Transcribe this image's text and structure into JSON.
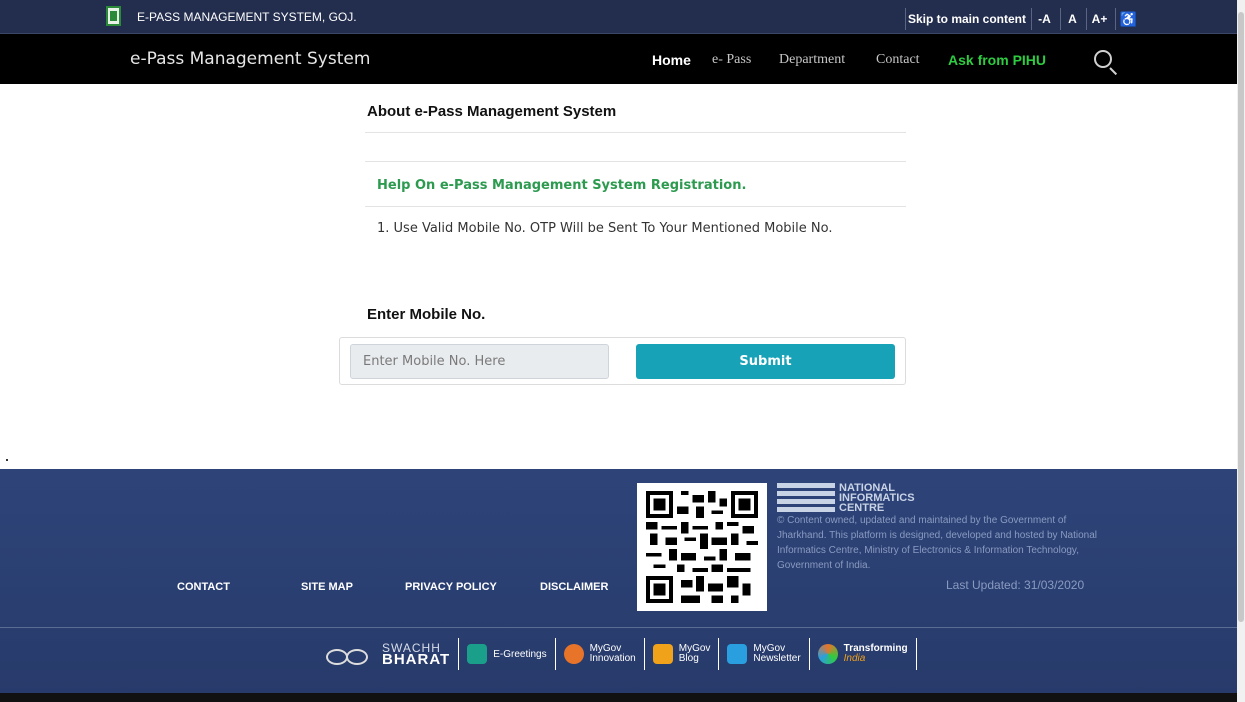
{
  "topbar": {
    "site_name": "E-PASS MANAGEMENT SYSTEM, GOJ.",
    "skip_label": "Skip to main content",
    "font_decrease": "-A",
    "font_normal": "A",
    "font_increase": "A+",
    "accessibility_icon": "accessibility-icon"
  },
  "navbar": {
    "brand": "e-Pass Management System",
    "items": {
      "home": "Home",
      "epass": "e- Pass",
      "department": "Department",
      "contact": "Contact",
      "pihu": "Ask from PIHU"
    },
    "search_icon": "search-icon"
  },
  "main": {
    "about_title": "About e-Pass Management System",
    "help_title": "Help On e-Pass Management System Registration.",
    "help_item": "1. Use Valid Mobile No. OTP Will be Sent To Your Mentioned Mobile No.",
    "mobile_title": "Enter Mobile No.",
    "mobile_placeholder": "Enter Mobile No. Here",
    "mobile_value": "",
    "submit_label": "Submit"
  },
  "footer": {
    "links": {
      "contact": "CONTACT",
      "sitemap": "SITE MAP",
      "privacy": "PRIVACY POLICY",
      "disclaimer": "DISCLAIMER"
    },
    "nic": {
      "line1": "NATIONAL",
      "line2": "INFORMATICS",
      "line3": "CENTRE",
      "description": "© Content owned, updated and maintained by the Government of Jharkhand. This platform is designed, developed and hosted by National Informatics Centre, Ministry of Electronics & Information Technology, Government of India."
    },
    "last_updated": "Last Updated: 31/03/2020",
    "partners": {
      "swachh_1": "SWACHH",
      "swachh_2": "BHARAT",
      "egreetings": "E-Greetings",
      "innovation_1": "MyGov",
      "innovation_2": "Innovation",
      "blog_1": "MyGov",
      "blog_2": "Blog",
      "newsletter_1": "MyGov",
      "newsletter_2": "Newsletter",
      "transforming_1": "Transforming",
      "transforming_2": "India"
    }
  },
  "colors": {
    "topbar": "#232d4e",
    "navbar": "#000000",
    "help_green": "#2c9a4f",
    "pihu_green": "#2ecc40",
    "submit": "#17a2b8",
    "footer": "#2e4479"
  }
}
